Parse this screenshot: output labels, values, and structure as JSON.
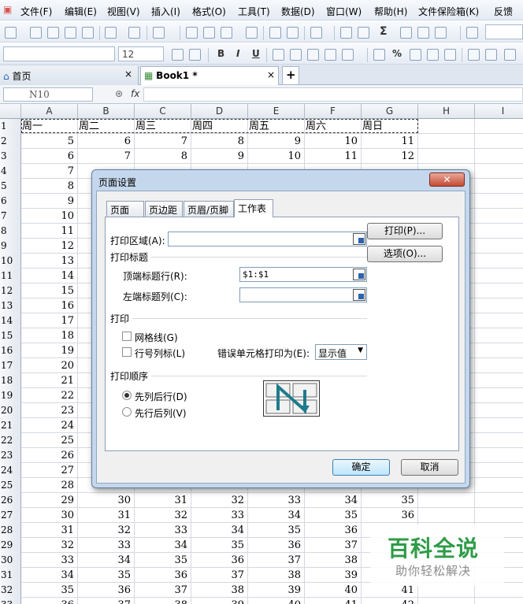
{
  "menu": [
    "文件(F)",
    "编辑(E)",
    "视图(V)",
    "插入(I)",
    "格式(O)",
    "工具(T)",
    "数据(D)",
    "窗口(W)",
    "帮助(H)",
    "文件保险箱(K)",
    "反馈"
  ],
  "toolbar": {
    "font_size": "12",
    "bold": "B",
    "italic": "I",
    "underline": "U",
    "percent": "%",
    "sum": "Σ"
  },
  "tabs": {
    "home": "首页",
    "doc": "Book1 *",
    "close": "×",
    "add": "+"
  },
  "formula_bar": {
    "name_box": "N10",
    "fx": "fx"
  },
  "columns": [
    "A",
    "B",
    "C",
    "D",
    "E",
    "F",
    "G",
    "H",
    "I"
  ],
  "rows": [
    {
      "n": "1",
      "cells": [
        "周一",
        "周二",
        "周三",
        "周四",
        "周五",
        "周六",
        "周日"
      ]
    },
    {
      "n": "2",
      "cells": [
        "5",
        "6",
        "7",
        "8",
        "9",
        "10",
        "11"
      ]
    },
    {
      "n": "3",
      "cells": [
        "6",
        "7",
        "8",
        "9",
        "10",
        "11",
        "12"
      ]
    },
    {
      "n": "4",
      "cells": [
        "7",
        "",
        "",
        "",
        "",
        "",
        ""
      ]
    },
    {
      "n": "5",
      "cells": [
        "8",
        "",
        "",
        "",
        "",
        "",
        ""
      ]
    },
    {
      "n": "6",
      "cells": [
        "9",
        "",
        "",
        "",
        "",
        "",
        ""
      ]
    },
    {
      "n": "7",
      "cells": [
        "10",
        "",
        "",
        "",
        "",
        "",
        ""
      ]
    },
    {
      "n": "8",
      "cells": [
        "11",
        "",
        "",
        "",
        "",
        "",
        ""
      ]
    },
    {
      "n": "9",
      "cells": [
        "12",
        "",
        "",
        "",
        "",
        "",
        ""
      ]
    },
    {
      "n": "10",
      "cells": [
        "13",
        "",
        "",
        "",
        "",
        "",
        ""
      ]
    },
    {
      "n": "11",
      "cells": [
        "14",
        "",
        "",
        "",
        "",
        "",
        ""
      ]
    },
    {
      "n": "12",
      "cells": [
        "15",
        "",
        "",
        "",
        "",
        "",
        ""
      ]
    },
    {
      "n": "13",
      "cells": [
        "16",
        "",
        "",
        "",
        "",
        "",
        ""
      ]
    },
    {
      "n": "14",
      "cells": [
        "17",
        "",
        "",
        "",
        "",
        "",
        ""
      ]
    },
    {
      "n": "15",
      "cells": [
        "18",
        "",
        "",
        "",
        "",
        "",
        ""
      ]
    },
    {
      "n": "16",
      "cells": [
        "19",
        "",
        "",
        "",
        "",
        "",
        ""
      ]
    },
    {
      "n": "17",
      "cells": [
        "20",
        "",
        "",
        "",
        "",
        "",
        ""
      ]
    },
    {
      "n": "18",
      "cells": [
        "21",
        "",
        "",
        "",
        "",
        "",
        ""
      ]
    },
    {
      "n": "19",
      "cells": [
        "22",
        "",
        "",
        "",
        "",
        "",
        ""
      ]
    },
    {
      "n": "20",
      "cells": [
        "23",
        "",
        "",
        "",
        "",
        "",
        ""
      ]
    },
    {
      "n": "21",
      "cells": [
        "24",
        "",
        "",
        "",
        "",
        "",
        ""
      ]
    },
    {
      "n": "22",
      "cells": [
        "25",
        "",
        "",
        "",
        "",
        "",
        ""
      ]
    },
    {
      "n": "23",
      "cells": [
        "26",
        "",
        "",
        "",
        "",
        "",
        ""
      ]
    },
    {
      "n": "24",
      "cells": [
        "27",
        "",
        "",
        "",
        "",
        "",
        ""
      ]
    },
    {
      "n": "25",
      "cells": [
        "28",
        "",
        "",
        "",
        "",
        "",
        ""
      ]
    },
    {
      "n": "26",
      "cells": [
        "29",
        "30",
        "31",
        "32",
        "33",
        "34",
        "35"
      ]
    },
    {
      "n": "27",
      "cells": [
        "30",
        "31",
        "32",
        "33",
        "34",
        "35",
        "36"
      ]
    },
    {
      "n": "28",
      "cells": [
        "31",
        "32",
        "33",
        "34",
        "35",
        "36",
        ""
      ]
    },
    {
      "n": "29",
      "cells": [
        "32",
        "33",
        "34",
        "35",
        "36",
        "37",
        ""
      ]
    },
    {
      "n": "30",
      "cells": [
        "33",
        "34",
        "35",
        "36",
        "37",
        "38",
        ""
      ]
    },
    {
      "n": "31",
      "cells": [
        "34",
        "35",
        "36",
        "37",
        "38",
        "39",
        ""
      ]
    },
    {
      "n": "32",
      "cells": [
        "35",
        "36",
        "37",
        "38",
        "39",
        "40",
        "41"
      ]
    },
    {
      "n": "33",
      "cells": [
        "36",
        "37",
        "38",
        "39",
        "40",
        "41",
        "42"
      ]
    }
  ],
  "dialog": {
    "title": "页面设置",
    "close": "✕",
    "tabs": [
      "页面",
      "页边距",
      "页眉/页脚",
      "工作表"
    ],
    "print_area_label": "打印区域(A):",
    "print_titles_label": "打印标题",
    "top_rows_label": "顶端标题行(R):",
    "top_rows_value": "$1:$1",
    "left_cols_label": "左端标题列(C):",
    "left_cols_value": "",
    "print_label": "打印",
    "gridlines_label": "网格线(G)",
    "row_col_headers_label": "行号列标(L)",
    "cell_errors_label": "错误单元格打印为(E):",
    "cell_errors_value": "显示值",
    "page_order_label": "打印顺序",
    "down_then_over": "先列后行(D)",
    "over_then_down": "先行后列(V)",
    "print_button": "打印(P)...",
    "options_button": "选项(O)...",
    "ok_button": "确定",
    "cancel_button": "取消"
  },
  "watermark": {
    "title": "百科全说",
    "subtitle": "助你轻松解决"
  },
  "colors": {
    "accent": "#2d63b0",
    "watermark_green": "#2e9b47",
    "close_red": "#c44b34"
  }
}
